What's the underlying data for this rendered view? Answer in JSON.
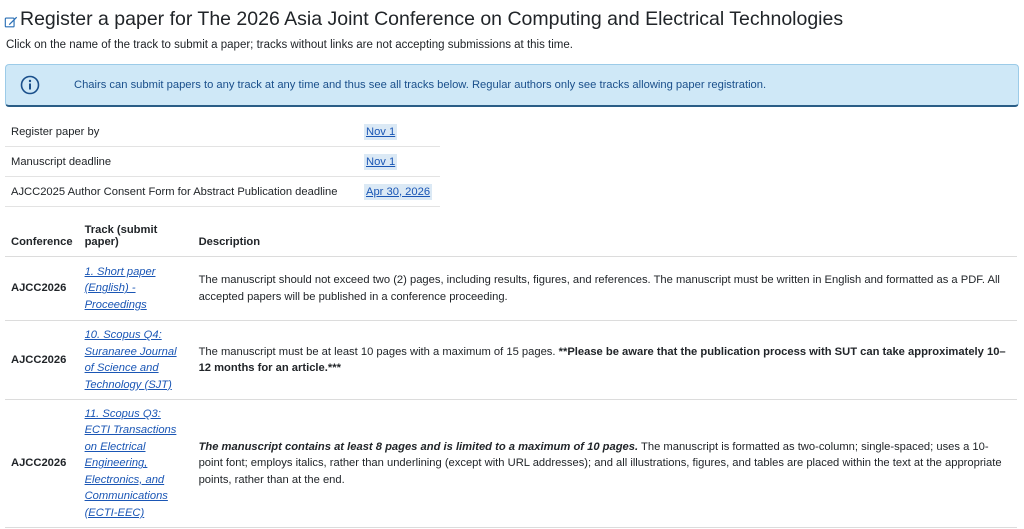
{
  "page": {
    "title": "Register a paper for The 2026 Asia Joint Conference on Computing and Electrical Technologies",
    "subtitle": "Click on the name of the track to submit a paper; tracks without links are not accepting submissions at this time.",
    "title_icon": "edit-icon"
  },
  "alert": {
    "icon": "info-icon",
    "text": "Chairs can submit papers to any track at any time and thus see all tracks below. Regular authors only see tracks allowing paper registration."
  },
  "deadlines": [
    {
      "label": "Register paper by",
      "value": "Nov 1"
    },
    {
      "label": "Manuscript deadline",
      "value": "Nov 1"
    },
    {
      "label": "AJCC2025 Author Consent Form for Abstract Publication deadline",
      "value": "Apr 30, 2026"
    }
  ],
  "tracks_table": {
    "headers": {
      "conference": "Conference",
      "track": "Track (submit paper)",
      "description": "Description"
    },
    "rows": [
      {
        "conference": "AJCC2026",
        "track": "1. Short paper (English) - Proceedings",
        "description_bold": "",
        "description": "The manuscript should not exceed two (2) pages, including results, figures, and references. The manuscript must be written in English and formatted as a PDF. All accepted papers will be published in a conference proceeding.",
        "description_tail_bold": ""
      },
      {
        "conference": "AJCC2026",
        "track": "10. Scopus Q4: Suranaree Journal of Science and Technology (SJT)",
        "description_bold": "",
        "description": "The manuscript must be at least 10 pages with a maximum of 15 pages. ",
        "description_tail_bold": "**Please be aware that the publication process with SUT can take approximately 10–12 months for an article.***"
      },
      {
        "conference": "AJCC2026",
        "track": "11. Scopus Q3: ECTI Transactions on Electrical Engineering, Electronics, and Communications (ECTI-EEC)",
        "description_bold": "The manuscript contains at least 8 pages and is limited to a maximum of 10 pages.",
        "description": " The manuscript is formatted as two-column; single-spaced; uses a 10-point font; employs italics, rather than underlining (except with URL addresses); and all illustrations, figures, and tables are placed within the text at the appropriate points, rather than at the end.",
        "description_tail_bold": ""
      }
    ]
  }
}
